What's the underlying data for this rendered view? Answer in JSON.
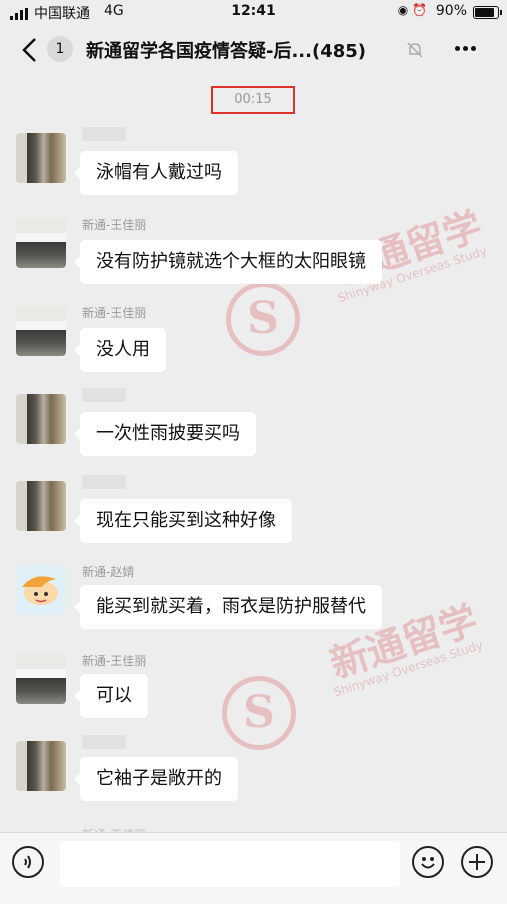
{
  "status_bar": {
    "carrier": "中国联通",
    "network": "4G",
    "time": "12:41",
    "battery_pct": "90%"
  },
  "header": {
    "back_count": "1",
    "title": "新通留学各国疫情答疑-后...(485)"
  },
  "timestamp": "00:15",
  "messages": [
    {
      "sender": "",
      "text": "泳帽有人戴过吗",
      "avatar": "photo"
    },
    {
      "sender": "新通-王佳丽",
      "text": "没有防护镜就选个大框的太阳眼镜",
      "avatar": "gate"
    },
    {
      "sender": "新通-王佳丽",
      "text": "没人用",
      "avatar": "gate"
    },
    {
      "sender": "",
      "text": "一次性雨披要买吗",
      "avatar": "photo"
    },
    {
      "sender": "",
      "text": "现在只能买到这种好像",
      "avatar": "photo"
    },
    {
      "sender": "新通-赵婧",
      "text": "能买到就买着，雨衣是防护服替代",
      "avatar": "cartoon"
    },
    {
      "sender": "新通-王佳丽",
      "text": "可以",
      "avatar": "gate"
    },
    {
      "sender": "",
      "text": "它袖子是敞开的",
      "avatar": "photo"
    }
  ],
  "partial_sender": "新通-王佳丽",
  "watermark": {
    "brand_cn": "新通留学",
    "brand_en": "Shinyway Overseas Study",
    "logo_letter": "S",
    "color": "#d0232b"
  },
  "icons": {
    "back": "chevron-left-icon",
    "mute": "bell-muted-icon",
    "more": "more-dots-icon",
    "voice": "voice-icon",
    "emoji": "emoji-icon",
    "plus": "plus-icon"
  }
}
